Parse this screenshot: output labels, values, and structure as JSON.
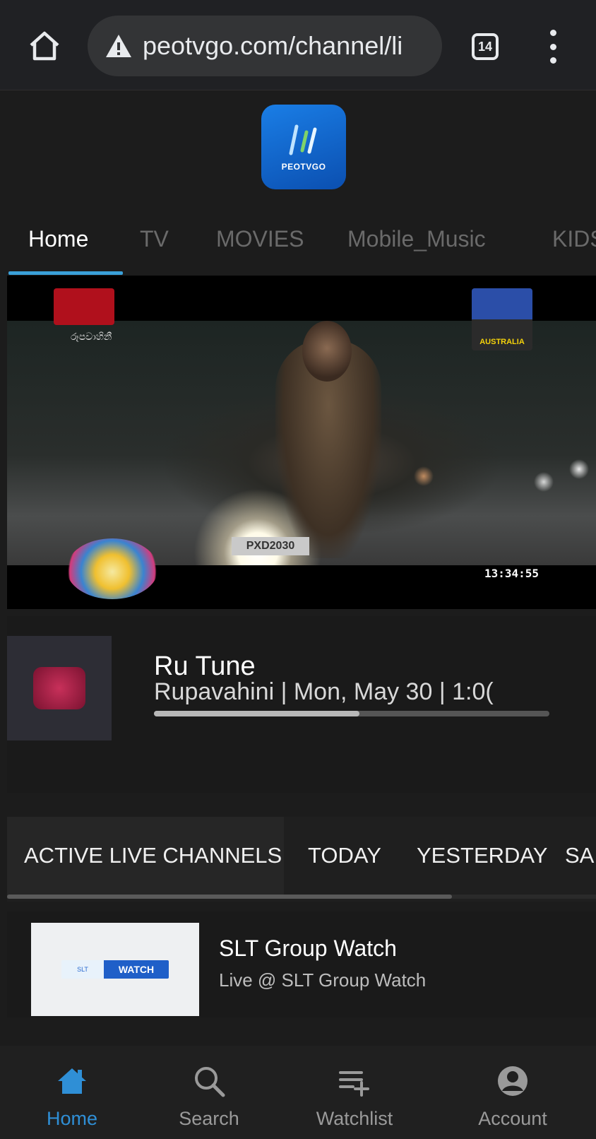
{
  "browser": {
    "url": "peotvgo.com/channel/li",
    "tab_count": "14"
  },
  "app": {
    "logo_text": "PEOTVGO"
  },
  "nav_tabs": [
    {
      "label": "Home",
      "active": true
    },
    {
      "label": "TV",
      "active": false
    },
    {
      "label": "MOVIES",
      "active": false
    },
    {
      "label": "Mobile_Music",
      "active": false
    },
    {
      "label": "KIDS",
      "active": false
    }
  ],
  "video": {
    "clock": "13:34:55",
    "channel_badge": "රූපවාහිනී",
    "event_badge": "AUSTRALIA"
  },
  "program": {
    "title": "Ru Tune",
    "subtitle": "Rupavahini  |  Mon, May 30  |  1:0(",
    "progress": 0.52
  },
  "channel_tabs": [
    {
      "label": "ACTIVE LIVE CHANNELS",
      "active": true
    },
    {
      "label": "TODAY",
      "active": false
    },
    {
      "label": "YESTERDAY",
      "active": false
    },
    {
      "label": "SA",
      "active": false
    }
  ],
  "channels": [
    {
      "name": "SLT Group Watch",
      "description": "Live @ SLT Group Watch",
      "thumb_label": "WATCH"
    }
  ],
  "bottom_nav": [
    {
      "label": "Home",
      "icon": "home-icon",
      "active": true
    },
    {
      "label": "Search",
      "icon": "search-icon",
      "active": false
    },
    {
      "label": "Watchlist",
      "icon": "watchlist-icon",
      "active": false
    },
    {
      "label": "Account",
      "icon": "account-icon",
      "active": false
    }
  ],
  "colors": {
    "accent": "#2f8fd6",
    "tab_underline": "#3aa0d8",
    "background": "#1c1c1c"
  }
}
